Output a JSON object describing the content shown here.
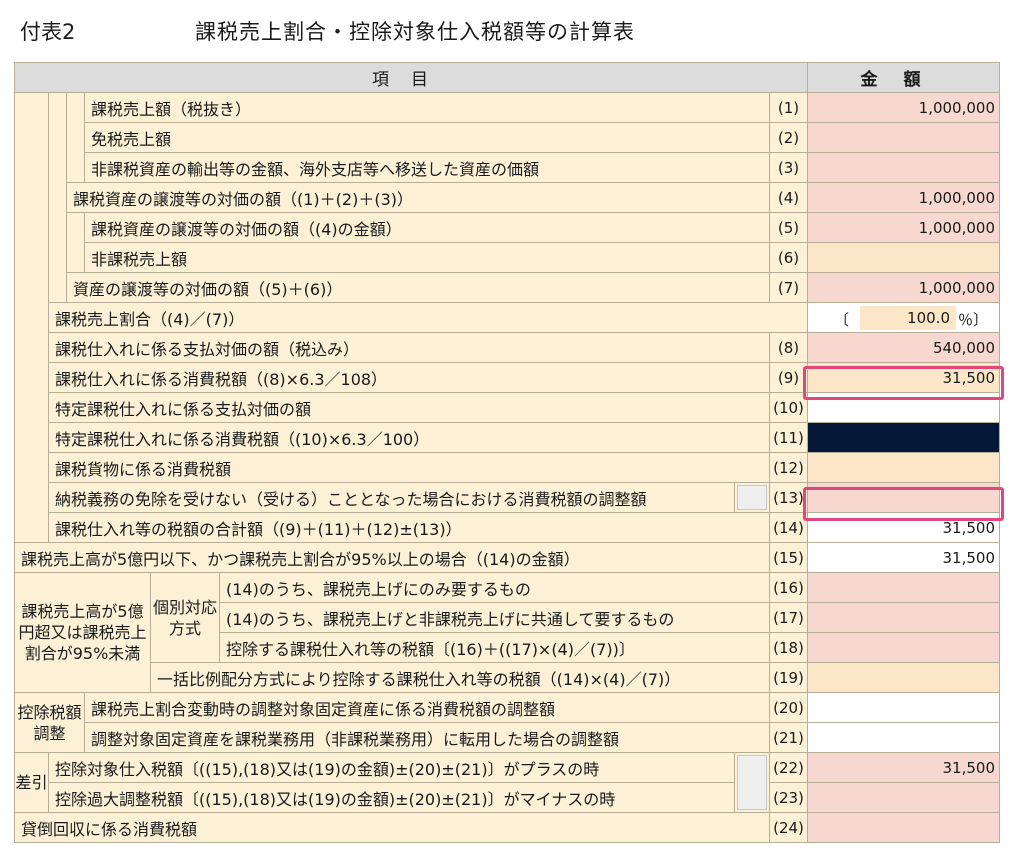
{
  "title": {
    "code": "付表2",
    "main": "課税売上割合・控除対象仕入税額等の計算表"
  },
  "header": {
    "item": "項目",
    "amount": "金額"
  },
  "groups": {
    "large_sales": "課税売上高が5億円超又は課税売上割合が95%未満",
    "individual": "個別対応方式",
    "adjust": "控除税額調整",
    "diff": "差引"
  },
  "rows": {
    "r1": {
      "label": "課税売上額（税抜き）",
      "num": "(1)",
      "amount": "1,000,000"
    },
    "r2": {
      "label": "免税売上額",
      "num": "(2)",
      "amount": ""
    },
    "r3": {
      "label": "非課税資産の輸出等の金額、海外支店等へ移送した資産の価額",
      "num": "(3)",
      "amount": ""
    },
    "r4": {
      "label": "課税資産の譲渡等の対価の額（(1)＋(2)＋(3)）",
      "num": "(4)",
      "amount": "1,000,000"
    },
    "r5": {
      "label": "課税資産の譲渡等の対価の額（(4)の金額）",
      "num": "(5)",
      "amount": "1,000,000"
    },
    "r6": {
      "label": "非課税売上額",
      "num": "(6)",
      "amount": ""
    },
    "r7": {
      "label": "資産の譲渡等の対価の額（(5)＋(6)）",
      "num": "(7)",
      "amount": "1,000,000"
    },
    "ratio": {
      "label": "課税売上割合（(4)／(7)）",
      "open": "〔",
      "value": "100.0",
      "unit": "％〕"
    },
    "r8": {
      "label": "課税仕入れに係る支払対価の額（税込み）",
      "num": "(8)",
      "amount": "540,000"
    },
    "r9": {
      "label": "課税仕入れに係る消費税額（(8)×6.3／108）",
      "num": "(9)",
      "amount": "31,500"
    },
    "r10": {
      "label": "特定課税仕入れに係る支払対価の額",
      "num": "(10)",
      "amount": ""
    },
    "r11": {
      "label": "特定課税仕入れに係る消費税額（(10)×6.3／100）",
      "num": "(11)",
      "amount": ""
    },
    "r12": {
      "label": "課税貨物に係る消費税額",
      "num": "(12)",
      "amount": ""
    },
    "r13": {
      "label": "納税義務の免除を受けない（受ける）こととなった場合における消費税額の調整額",
      "num": "(13)",
      "amount": ""
    },
    "r14": {
      "label": "課税仕入れ等の税額の合計額（(9)＋(11)＋(12)±(13)）",
      "num": "(14)",
      "amount": "31,500"
    },
    "r15": {
      "label": "課税売上高が5億円以下、かつ課税売上割合が95%以上の場合（(14)の金額）",
      "num": "(15)",
      "amount": "31,500"
    },
    "r16": {
      "label": "(14)のうち、課税売上げにのみ要するもの",
      "num": "(16)",
      "amount": ""
    },
    "r17": {
      "label": "(14)のうち、課税売上げと非課税売上げに共通して要するもの",
      "num": "(17)",
      "amount": ""
    },
    "r18": {
      "label": "控除する課税仕入れ等の税額〔(16)＋((17)×(4)／(7))〕",
      "num": "(18)",
      "amount": ""
    },
    "r19": {
      "label": "一括比例配分方式により控除する課税仕入れ等の税額（(14)×(4)／(7)）",
      "num": "(19)",
      "amount": ""
    },
    "r20": {
      "label": "課税売上割合変動時の調整対象固定資産に係る消費税額の調整額",
      "num": "(20)",
      "amount": ""
    },
    "r21": {
      "label": "調整対象固定資産を課税業務用（非課税業務用）に転用した場合の調整額",
      "num": "(21)",
      "amount": ""
    },
    "r22": {
      "label": "控除対象仕入税額〔((15),(18)又は(19)の金額)±(20)±(21)〕がプラスの時",
      "num": "(22)",
      "amount": "31,500"
    },
    "r23": {
      "label": "控除過大調整税額〔((15),(18)又は(19)の金額)±(20)±(21)〕がマイナスの時",
      "num": "(23)",
      "amount": ""
    },
    "r24": {
      "label": "貸倒回収に係る消費税額",
      "num": "(24)",
      "amount": ""
    }
  },
  "colors": {
    "label_bg": "#fcf1d7",
    "amount_pink": "#f7d8d0",
    "amount_peach": "#fce6c8",
    "highlight": "#e2467b",
    "dark_cell": "#061837"
  }
}
